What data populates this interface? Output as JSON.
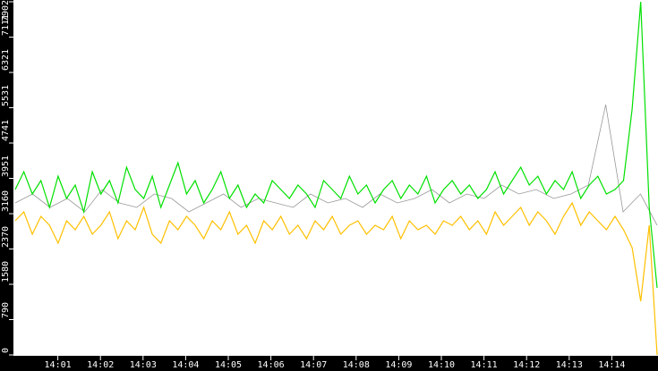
{
  "chart_data": {
    "type": "line",
    "title": "",
    "xlabel": "",
    "ylabel": "",
    "ylim": [
      0,
      7902
    ],
    "xlim_minutes_after_1400": [
      0,
      15.08
    ],
    "y_ticks": [
      "0",
      "790",
      "1580",
      "2370",
      "3160",
      "3951",
      "4741",
      "5531",
      "6321",
      "7111",
      "7902"
    ],
    "y_tick_values": [
      0,
      790,
      1580,
      2370,
      3160,
      3951,
      4741,
      5531,
      6321,
      7111,
      7902
    ],
    "x_ticks": [
      "14:01",
      "14:02",
      "14:03",
      "14:04",
      "14:05",
      "14:06",
      "14:07",
      "14:08",
      "14:09",
      "14:10",
      "14:11",
      "14:12",
      "14:13",
      "14:14"
    ],
    "x_tick_values": [
      1,
      2,
      3,
      4,
      5,
      6,
      7,
      8,
      9,
      10,
      11,
      12,
      13,
      14
    ],
    "series": [
      {
        "name": "grey",
        "color": "#999999",
        "values": [
          3400,
          3600,
          3300,
          3500,
          3200,
          3700,
          3400,
          3300,
          3600,
          3500,
          3200,
          3400,
          3600,
          3300,
          3500,
          3400,
          3300,
          3600,
          3400,
          3500,
          3300,
          3600,
          3400,
          3500,
          3700,
          3400,
          3600,
          3500,
          3800,
          3600,
          3700,
          3500,
          3600,
          3800,
          5600,
          3200,
          3600,
          2900
        ]
      },
      {
        "name": "green",
        "color": "#00e000",
        "values": [
          3700,
          4100,
          3600,
          3900,
          3300,
          4000,
          3500,
          3800,
          3200,
          4100,
          3600,
          3900,
          3400,
          4200,
          3700,
          3500,
          4000,
          3300,
          3800,
          4300,
          3600,
          3900,
          3400,
          3700,
          4100,
          3500,
          3800,
          3300,
          3600,
          3400,
          3900,
          3700,
          3500,
          3800,
          3600,
          3300,
          3900,
          3700,
          3500,
          4000,
          3600,
          3800,
          3400,
          3700,
          3900,
          3500,
          3800,
          3600,
          4000,
          3400,
          3700,
          3900,
          3600,
          3800,
          3500,
          3700,
          4100,
          3600,
          3900,
          4200,
          3800,
          4000,
          3600,
          3900,
          3700,
          4100,
          3500,
          3800,
          4000,
          3600,
          3700,
          3900,
          5500,
          7902,
          3300,
          1500
        ]
      },
      {
        "name": "yellow",
        "color": "#ffc000",
        "values": [
          3000,
          3200,
          2700,
          3100,
          2900,
          2500,
          3000,
          2800,
          3100,
          2700,
          2900,
          3200,
          2600,
          3000,
          2800,
          3300,
          2700,
          2500,
          3000,
          2800,
          3100,
          2900,
          2600,
          3000,
          2800,
          3200,
          2700,
          2900,
          2500,
          3000,
          2800,
          3100,
          2700,
          2900,
          2600,
          3000,
          2800,
          3100,
          2700,
          2900,
          3000,
          2700,
          2900,
          2800,
          3100,
          2600,
          3000,
          2800,
          2900,
          2700,
          3000,
          2900,
          3100,
          2800,
          3000,
          2700,
          3200,
          2900,
          3100,
          3300,
          2900,
          3200,
          3000,
          2700,
          3100,
          3400,
          2900,
          3200,
          3000,
          2800,
          3100,
          2800,
          2400,
          1200,
          2900,
          0
        ]
      }
    ]
  }
}
